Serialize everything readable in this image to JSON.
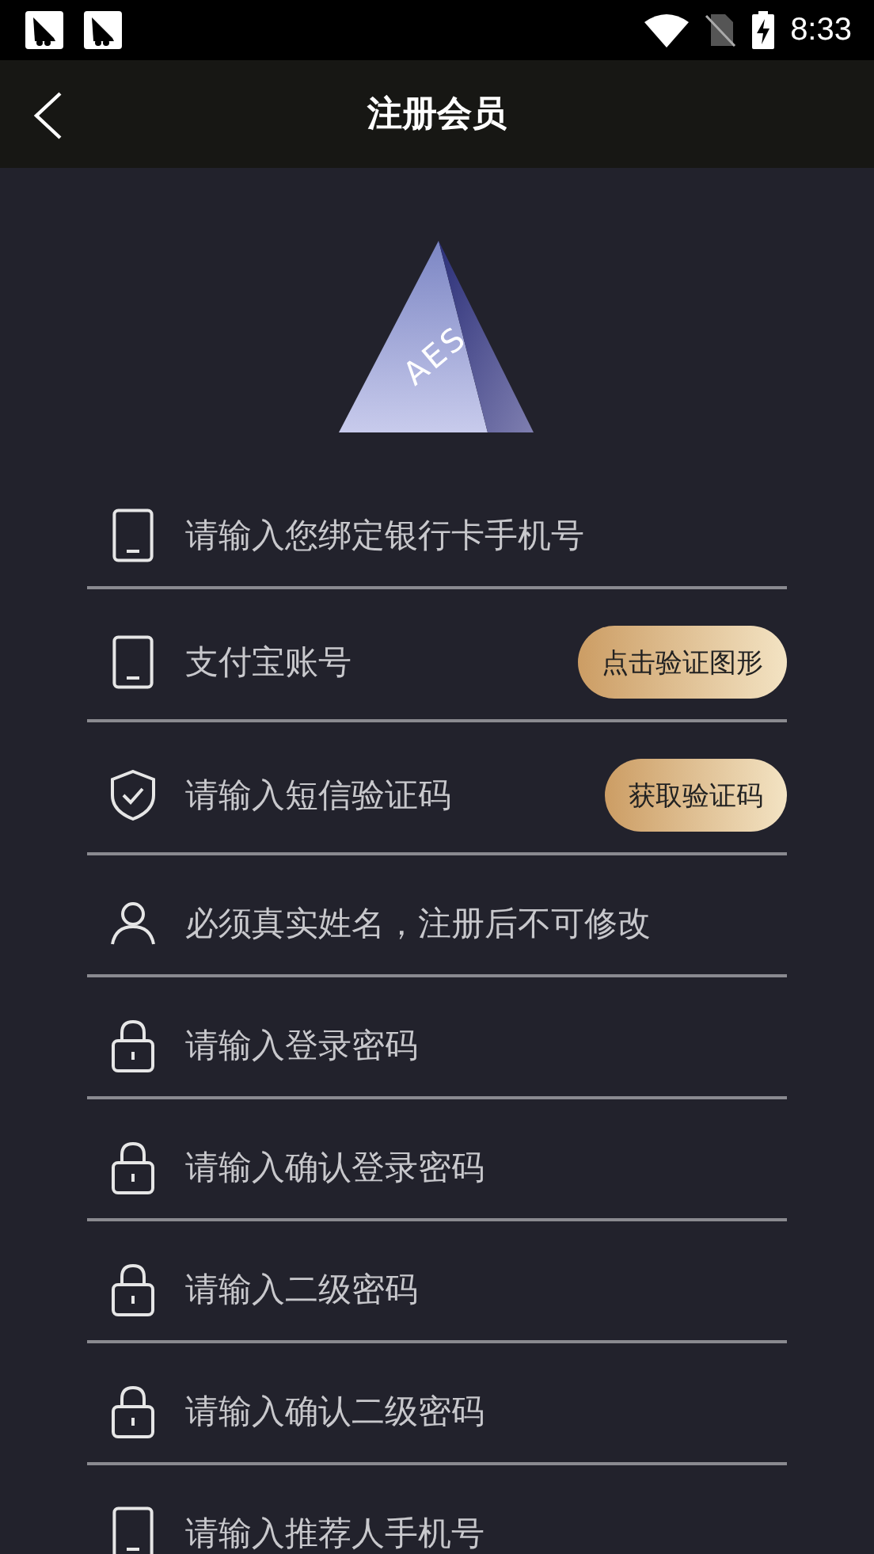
{
  "status_bar": {
    "time": "8:33"
  },
  "app_bar": {
    "title": "注册会员"
  },
  "logo": {
    "text": "AES"
  },
  "fields": [
    {
      "kind": "phone",
      "placeholder": "请输入您绑定银行卡手机号"
    },
    {
      "kind": "phone",
      "placeholder": "支付宝账号",
      "button": "点击验证图形"
    },
    {
      "kind": "shield",
      "placeholder": "请输入短信验证码",
      "button": "获取验证码"
    },
    {
      "kind": "person",
      "placeholder": "必须真实姓名，注册后不可修改"
    },
    {
      "kind": "lock",
      "placeholder": "请输入登录密码"
    },
    {
      "kind": "lock",
      "placeholder": "请输入确认登录密码"
    },
    {
      "kind": "lock",
      "placeholder": "请输入二级密码"
    },
    {
      "kind": "lock",
      "placeholder": "请输入确认二级密码"
    },
    {
      "kind": "phone",
      "placeholder": "请输入推荐人手机号"
    }
  ]
}
